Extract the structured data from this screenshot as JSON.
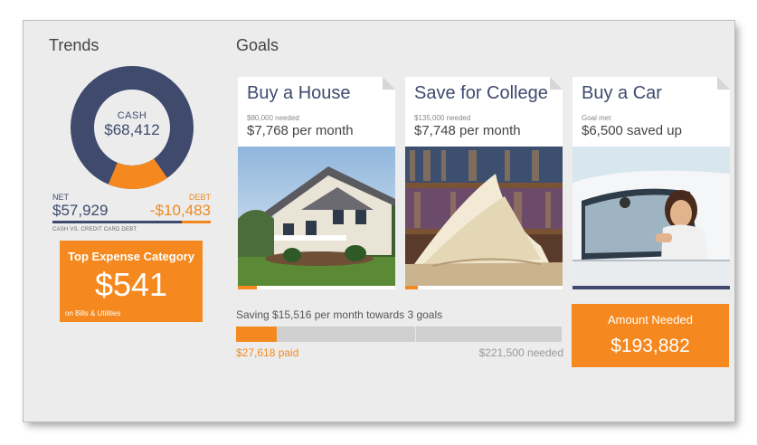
{
  "trends": {
    "title": "Trends",
    "donut": {
      "caption": "CASH",
      "value": "$68,412",
      "cash_fraction": 0.84,
      "debt_fraction": 0.16
    },
    "net": {
      "caption": "NET",
      "value": "$57,929"
    },
    "debt": {
      "caption": "DEBT",
      "value": "-$10,483"
    },
    "note": "CASH VS. CREDIT CARD DEBT",
    "expense": {
      "title": "Top Expense Category",
      "value": "$541",
      "subtitle": "on Bills & Utilities"
    }
  },
  "goals": {
    "title": "Goals",
    "cards": [
      {
        "title": "Buy a House",
        "caption": "$80,000 needed",
        "amount": "$7,768 per month",
        "photo": "house-photo",
        "progress": 0.12
      },
      {
        "title": "Save for College",
        "caption": "$135,000 needed",
        "amount": "$7,748 per month",
        "photo": "book-photo",
        "progress": 0.08
      },
      {
        "title": "Buy a Car",
        "caption": "Goal met",
        "amount": "$6,500 saved up",
        "photo": "car-photo",
        "progress": 1.0
      }
    ],
    "summary": {
      "saving_text": "Saving $15,516 per month towards 3 goals",
      "paid": "$27,618 paid",
      "needed": "$221,500 needed",
      "paid_fraction": 0.125
    },
    "amount_needed": {
      "title": "Amount Needed",
      "value": "$193,882"
    }
  },
  "colors": {
    "navy": "#3f4a6d",
    "orange": "#f5891f",
    "background": "#ececec"
  }
}
